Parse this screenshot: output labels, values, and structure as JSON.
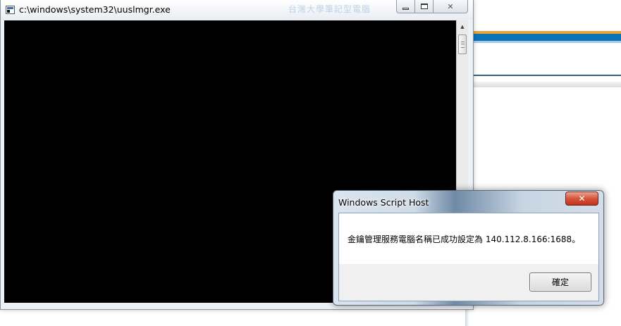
{
  "console_window": {
    "title": "c:\\windows\\system32\\uuslmgr.exe",
    "faded_title": "台灣大學筆記型電腦",
    "icon": "console-app-icon",
    "controls": {
      "minimize_icon": "minimize-icon",
      "maximize_icon": "maximize-icon",
      "close_glyph": "✕"
    },
    "scroll_up_glyph": "▲"
  },
  "dialog": {
    "title": "Windows Script Host",
    "close_glyph": "✕",
    "message": "金鑰管理服務電腦名稱已成功設定為 140.112.8.166:1688。",
    "ok_label": "確定"
  },
  "colors": {
    "console_bg": "#000000",
    "accent_orange": "#e8a33c",
    "accent_blue": "#0a73b8",
    "close_red": "#c7391f"
  }
}
